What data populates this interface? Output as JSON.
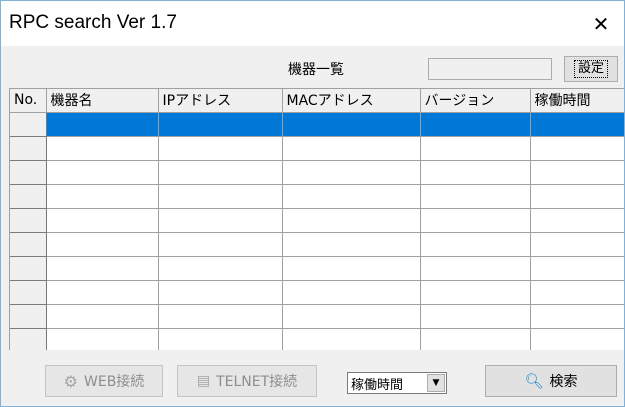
{
  "window": {
    "title": "RPC search Ver 1.7",
    "close_glyph": "✕"
  },
  "header": {
    "list_title": "機器一覧",
    "settings_label": "設定"
  },
  "table": {
    "columns": [
      "No.",
      "機器名",
      "IPアドレス",
      "MACアドレス",
      "バージョン",
      "稼働時間"
    ],
    "row_count": 10,
    "selected_row": 0
  },
  "footer": {
    "web_button": "WEB接続",
    "telnet_button": "TELNET接続",
    "sort_select": "稼働時間",
    "search_button": "検索"
  },
  "icons": {
    "web": "gear-icon",
    "telnet": "server-icon",
    "search": "magnifier-icon",
    "dropdown": "chevron-down-icon"
  },
  "colors": {
    "selection": "#0078d7",
    "window_border": "#7fb2d9",
    "search_icon": "#1f8ad2"
  }
}
